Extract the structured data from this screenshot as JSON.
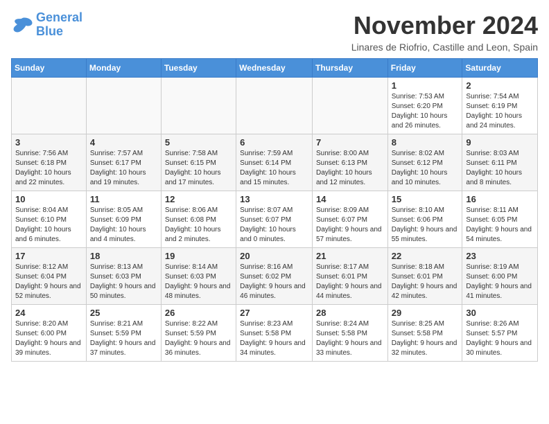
{
  "logo": {
    "line1": "General",
    "line2": "Blue"
  },
  "title": "November 2024",
  "subtitle": "Linares de Riofrio, Castille and Leon, Spain",
  "weekdays": [
    "Sunday",
    "Monday",
    "Tuesday",
    "Wednesday",
    "Thursday",
    "Friday",
    "Saturday"
  ],
  "weeks": [
    [
      {
        "day": "",
        "info": ""
      },
      {
        "day": "",
        "info": ""
      },
      {
        "day": "",
        "info": ""
      },
      {
        "day": "",
        "info": ""
      },
      {
        "day": "",
        "info": ""
      },
      {
        "day": "1",
        "info": "Sunrise: 7:53 AM\nSunset: 6:20 PM\nDaylight: 10 hours and 26 minutes."
      },
      {
        "day": "2",
        "info": "Sunrise: 7:54 AM\nSunset: 6:19 PM\nDaylight: 10 hours and 24 minutes."
      }
    ],
    [
      {
        "day": "3",
        "info": "Sunrise: 7:56 AM\nSunset: 6:18 PM\nDaylight: 10 hours and 22 minutes."
      },
      {
        "day": "4",
        "info": "Sunrise: 7:57 AM\nSunset: 6:17 PM\nDaylight: 10 hours and 19 minutes."
      },
      {
        "day": "5",
        "info": "Sunrise: 7:58 AM\nSunset: 6:15 PM\nDaylight: 10 hours and 17 minutes."
      },
      {
        "day": "6",
        "info": "Sunrise: 7:59 AM\nSunset: 6:14 PM\nDaylight: 10 hours and 15 minutes."
      },
      {
        "day": "7",
        "info": "Sunrise: 8:00 AM\nSunset: 6:13 PM\nDaylight: 10 hours and 12 minutes."
      },
      {
        "day": "8",
        "info": "Sunrise: 8:02 AM\nSunset: 6:12 PM\nDaylight: 10 hours and 10 minutes."
      },
      {
        "day": "9",
        "info": "Sunrise: 8:03 AM\nSunset: 6:11 PM\nDaylight: 10 hours and 8 minutes."
      }
    ],
    [
      {
        "day": "10",
        "info": "Sunrise: 8:04 AM\nSunset: 6:10 PM\nDaylight: 10 hours and 6 minutes."
      },
      {
        "day": "11",
        "info": "Sunrise: 8:05 AM\nSunset: 6:09 PM\nDaylight: 10 hours and 4 minutes."
      },
      {
        "day": "12",
        "info": "Sunrise: 8:06 AM\nSunset: 6:08 PM\nDaylight: 10 hours and 2 minutes."
      },
      {
        "day": "13",
        "info": "Sunrise: 8:07 AM\nSunset: 6:07 PM\nDaylight: 10 hours and 0 minutes."
      },
      {
        "day": "14",
        "info": "Sunrise: 8:09 AM\nSunset: 6:07 PM\nDaylight: 9 hours and 57 minutes."
      },
      {
        "day": "15",
        "info": "Sunrise: 8:10 AM\nSunset: 6:06 PM\nDaylight: 9 hours and 55 minutes."
      },
      {
        "day": "16",
        "info": "Sunrise: 8:11 AM\nSunset: 6:05 PM\nDaylight: 9 hours and 54 minutes."
      }
    ],
    [
      {
        "day": "17",
        "info": "Sunrise: 8:12 AM\nSunset: 6:04 PM\nDaylight: 9 hours and 52 minutes."
      },
      {
        "day": "18",
        "info": "Sunrise: 8:13 AM\nSunset: 6:03 PM\nDaylight: 9 hours and 50 minutes."
      },
      {
        "day": "19",
        "info": "Sunrise: 8:14 AM\nSunset: 6:03 PM\nDaylight: 9 hours and 48 minutes."
      },
      {
        "day": "20",
        "info": "Sunrise: 8:16 AM\nSunset: 6:02 PM\nDaylight: 9 hours and 46 minutes."
      },
      {
        "day": "21",
        "info": "Sunrise: 8:17 AM\nSunset: 6:01 PM\nDaylight: 9 hours and 44 minutes."
      },
      {
        "day": "22",
        "info": "Sunrise: 8:18 AM\nSunset: 6:01 PM\nDaylight: 9 hours and 42 minutes."
      },
      {
        "day": "23",
        "info": "Sunrise: 8:19 AM\nSunset: 6:00 PM\nDaylight: 9 hours and 41 minutes."
      }
    ],
    [
      {
        "day": "24",
        "info": "Sunrise: 8:20 AM\nSunset: 6:00 PM\nDaylight: 9 hours and 39 minutes."
      },
      {
        "day": "25",
        "info": "Sunrise: 8:21 AM\nSunset: 5:59 PM\nDaylight: 9 hours and 37 minutes."
      },
      {
        "day": "26",
        "info": "Sunrise: 8:22 AM\nSunset: 5:59 PM\nDaylight: 9 hours and 36 minutes."
      },
      {
        "day": "27",
        "info": "Sunrise: 8:23 AM\nSunset: 5:58 PM\nDaylight: 9 hours and 34 minutes."
      },
      {
        "day": "28",
        "info": "Sunrise: 8:24 AM\nSunset: 5:58 PM\nDaylight: 9 hours and 33 minutes."
      },
      {
        "day": "29",
        "info": "Sunrise: 8:25 AM\nSunset: 5:58 PM\nDaylight: 9 hours and 32 minutes."
      },
      {
        "day": "30",
        "info": "Sunrise: 8:26 AM\nSunset: 5:57 PM\nDaylight: 9 hours and 30 minutes."
      }
    ]
  ]
}
